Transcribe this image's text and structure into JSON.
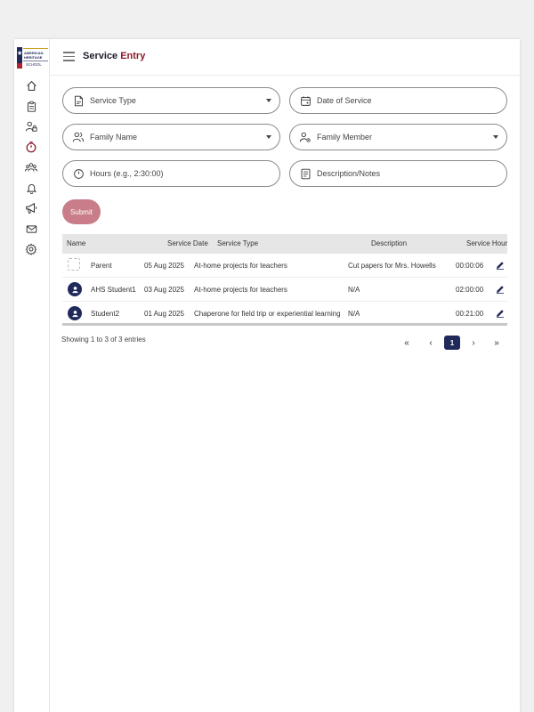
{
  "header": {
    "title_main": "Service ",
    "title_accent": "Entry"
  },
  "logo": {
    "line1": "AMERICAN",
    "line2": "HERITAGE",
    "line3": "SCHOOL"
  },
  "sidebar": {
    "items": [
      {
        "icon": "home-icon"
      },
      {
        "icon": "clipboard-icon"
      },
      {
        "icon": "users-lock-icon"
      },
      {
        "icon": "timer-icon",
        "active": true
      },
      {
        "icon": "community-icon"
      },
      {
        "icon": "bell-icon"
      },
      {
        "icon": "megaphone-icon"
      },
      {
        "icon": "mail-icon"
      },
      {
        "icon": "settings-icon"
      }
    ]
  },
  "form": {
    "service_type": "Service Type",
    "date_of_service": "Date of Service",
    "family_name": "Family Name",
    "family_member": "Family Member",
    "hours": "Hours (e.g., 2:30:00)",
    "description": "Description/Notes",
    "submit_label": "Submit"
  },
  "table": {
    "columns": [
      "Name",
      "Service Date",
      "Service Type",
      "Description",
      "Service Hour"
    ],
    "rows": [
      {
        "name": "Parent",
        "date": "05 Aug 2025",
        "type": "At-home projects for teachers",
        "description": "Cut papers for Mrs. Howells",
        "hours": "00:00:06"
      },
      {
        "name": "AHS Student1",
        "date": "03 Aug 2025",
        "type": "At-home projects for teachers",
        "description": "N/A",
        "hours": "02:00:00"
      },
      {
        "name": "Student2",
        "date": "01 Aug 2025",
        "type": "Chaperone for field trip or experiential learning",
        "description": "N/A",
        "hours": "00:21:00"
      }
    ]
  },
  "pagination": {
    "summary": "Showing 1 to 3 of 3 entries",
    "first": "«",
    "prev": "‹",
    "current": "1",
    "next": "›",
    "last": "»"
  },
  "colors": {
    "accent": "#8b1a2b",
    "navy": "#1f2a5a",
    "submit": "#c97d8a"
  }
}
